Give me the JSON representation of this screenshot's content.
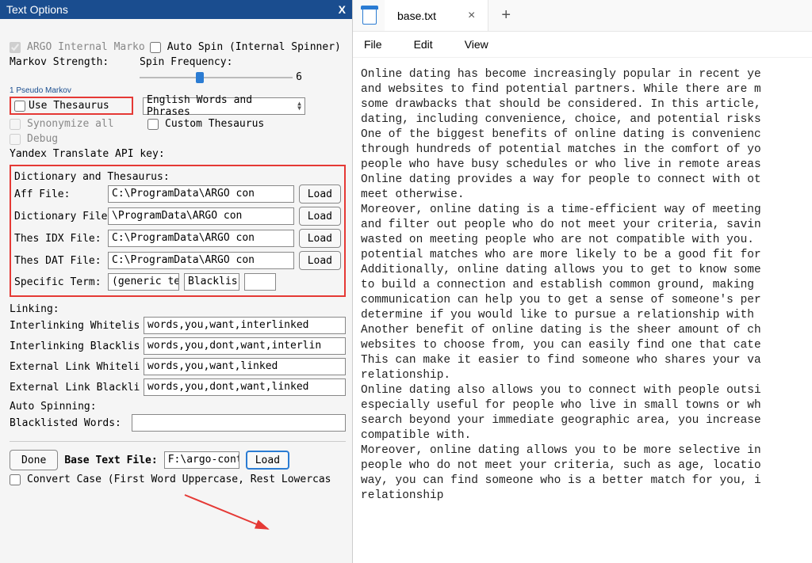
{
  "dialog": {
    "title": "Text Options",
    "argo_internal_markov": "ARGO Internal Marko",
    "auto_spin": "Auto Spin (Internal Spinner)",
    "markov_strength": "Markov Strength:",
    "spin_frequency": "Spin Frequency:",
    "spin_value": "6",
    "pseudo_markov": "1 Pseudo Markov",
    "use_thesaurus": "Use Thesaurus",
    "thesaurus_select": "English Words and Phrases",
    "synonymize_all": "Synonymize all",
    "custom_thesaurus": "Custom Thesaurus",
    "debug": "Debug",
    "yandex_label": "Yandex Translate API key:",
    "dict_section_label": "Dictionary and Thesaurus:",
    "aff_file_label": "Aff File:",
    "aff_file_value": "C:\\ProgramData\\ARGO con",
    "dictionary_file_label": "Dictionary File:",
    "dictionary_file_value": "\\ProgramData\\ARGO con",
    "thes_idx_label": "Thes IDX File:",
    "thes_idx_value": "C:\\ProgramData\\ARGO con",
    "thes_dat_label": "Thes DAT File:",
    "thes_dat_value": "C:\\ProgramData\\ARGO con",
    "specific_term_label": "Specific Term:",
    "specific_term_value1": "(generic ter",
    "specific_term_value2": "Blacklis",
    "load_label": "Load",
    "linking_label": "Linking:",
    "interlink_whitelist_label": "Interlinking Whitelis",
    "interlink_whitelist_value": "words,you,want,interlinked",
    "interlink_blacklist_label": "Interlinking Blacklis",
    "interlink_blacklist_value": "words,you,dont,want,interlin",
    "external_whitelist_label": "External Link Whiteli",
    "external_whitelist_value": "words,you,want,linked",
    "external_blacklist_label": "External Link Blackli",
    "external_blacklist_value": "words,you,dont,want,linked",
    "auto_spinning_label": "Auto Spinning:",
    "blacklisted_words_label": "Blacklisted Words:",
    "done_label": "Done",
    "base_text_file_label": "Base Text File:",
    "base_text_file_value": "F:\\argo-cont",
    "convert_case": "Convert Case (First Word Uppercase, Rest Lowercas"
  },
  "notepad": {
    "tab_name": "base.txt",
    "menu": {
      "file": "File",
      "edit": "Edit",
      "view": "View"
    },
    "body": "Online dating has become increasingly popular in recent ye\nand websites to find potential partners. While there are m\nsome drawbacks that should be considered. In this article,\ndating, including convenience, choice, and potential risks\nOne of the biggest benefits of online dating is convenienc\nthrough hundreds of potential matches in the comfort of yo\npeople who have busy schedules or who live in remote areas\nOnline dating provides a way for people to connect with ot\nmeet otherwise.\nMoreover, online dating is a time-efficient way of meeting\nand filter out people who do not meet your criteria, savin\nwasted on meeting people who are not compatible with you. \npotential matches who are more likely to be a good fit for\nAdditionally, online dating allows you to get to know some\nto build a connection and establish common ground, making \ncommunication can help you to get a sense of someone's per\ndetermine if you would like to pursue a relationship with \nAnother benefit of online dating is the sheer amount of ch\nwebsites to choose from, you can easily find one that cate\nThis can make it easier to find someone who shares your va\nrelationship.\nOnline dating also allows you to connect with people outsi\nespecially useful for people who live in small towns or wh\nsearch beyond your immediate geographic area, you increase\ncompatible with.\nMoreover, online dating allows you to be more selective in\npeople who do not meet your criteria, such as age, locatio\nway, you can find someone who is a better match for you, i\nrelationship"
  }
}
